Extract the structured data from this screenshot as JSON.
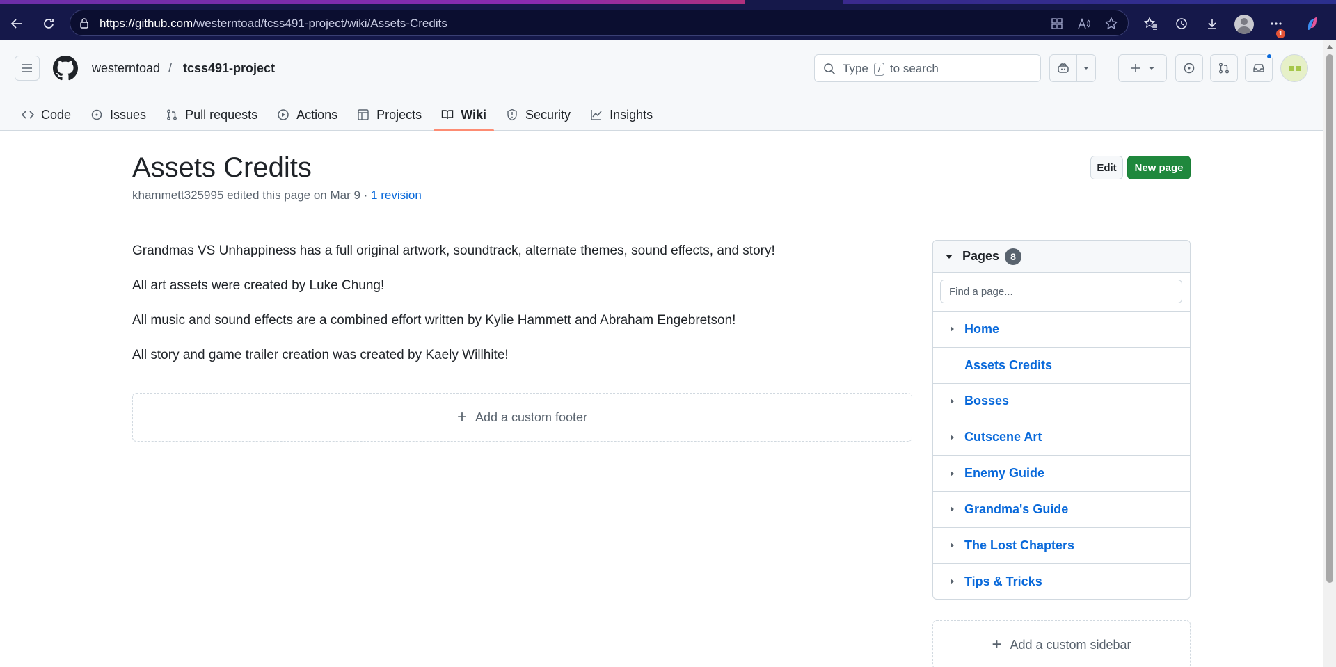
{
  "browser": {
    "url_host": "https://github.com",
    "url_path": "/westerntoad/tcss491-project/wiki/Assets-Credits",
    "notification_count": "1"
  },
  "header": {
    "owner": "westerntoad",
    "separator": "/",
    "repo": "tcss491-project",
    "search": {
      "prefix": "Type",
      "key": "/",
      "suffix": "to search"
    }
  },
  "tabs": [
    {
      "label": "Code",
      "icon": "code-icon"
    },
    {
      "label": "Issues",
      "icon": "issue-icon"
    },
    {
      "label": "Pull requests",
      "icon": "pull-request-icon"
    },
    {
      "label": "Actions",
      "icon": "play-icon"
    },
    {
      "label": "Projects",
      "icon": "table-icon"
    },
    {
      "label": "Wiki",
      "icon": "book-icon",
      "active": true
    },
    {
      "label": "Security",
      "icon": "shield-icon"
    },
    {
      "label": "Insights",
      "icon": "graph-icon"
    }
  ],
  "wiki": {
    "title": "Assets Credits",
    "meta_text": "khammett325995 edited this page on Mar 9 · ",
    "revision_link": "1 revision",
    "edit_label": "Edit",
    "new_page_label": "New page",
    "paragraphs": [
      "Grandmas VS Unhappiness has a full original artwork, soundtrack, alternate themes, sound effects, and story!",
      "All art assets were created by Luke Chung!",
      "All music and sound effects are a combined effort written by Kylie Hammett and Abraham Engebretson!",
      "All story and game trailer creation was created by Kaely Willhite!"
    ],
    "add_footer_label": "Add a custom footer",
    "add_sidebar_label": "Add a custom sidebar"
  },
  "pages": {
    "title": "Pages",
    "count": "8",
    "find_placeholder": "Find a page...",
    "items": [
      {
        "label": "Home",
        "expandable": true
      },
      {
        "label": "Assets Credits",
        "expandable": false
      },
      {
        "label": "Bosses",
        "expandable": true
      },
      {
        "label": "Cutscene Art",
        "expandable": true
      },
      {
        "label": "Enemy Guide",
        "expandable": true
      },
      {
        "label": "Grandma's Guide",
        "expandable": true
      },
      {
        "label": "The Lost Chapters",
        "expandable": true
      },
      {
        "label": "Tips & Tricks",
        "expandable": true
      }
    ]
  },
  "colors": {
    "accent_blue": "#0969da",
    "primary_green": "#1f883d",
    "tab_underline": "#fd8c73",
    "browser_bar": "#15184a"
  }
}
